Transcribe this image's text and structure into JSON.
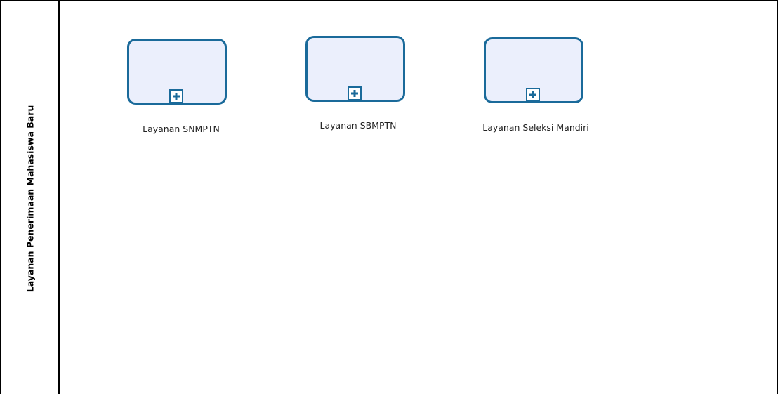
{
  "pool": {
    "lane_label": "Layanan Penerimaan Mahasiswa Baru"
  },
  "tasks": [
    {
      "label": "Layanan SNMPTN",
      "marker": "plus-expand-icon"
    },
    {
      "label": "Layanan SBMPTN",
      "marker": "plus-expand-icon"
    },
    {
      "label": "Layanan Seleksi Mandiri",
      "marker": "plus-expand-icon"
    }
  ],
  "colors": {
    "task_border": "#1a6a9a",
    "task_fill": "#ebeffc",
    "pool_border": "#000000"
  }
}
